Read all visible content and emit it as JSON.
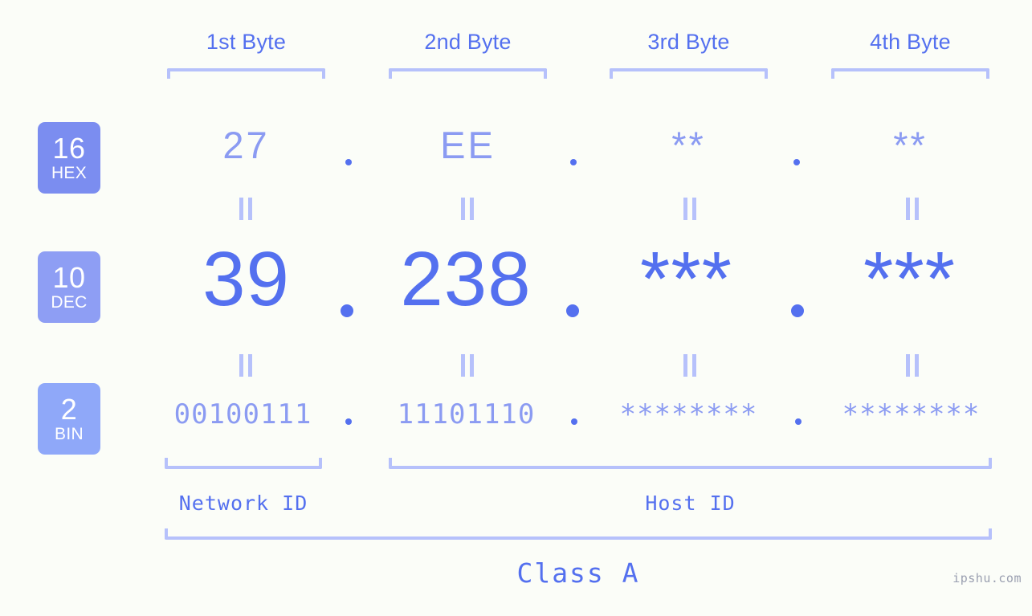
{
  "page": {
    "background_color": "#fbfdf8",
    "accent_color": "#5470ef",
    "muted_accent_color": "#8b9bf2",
    "bracket_color": "#b6c1fb",
    "watermark": "ipshu.com"
  },
  "columns": [
    {
      "label": "1st Byte"
    },
    {
      "label": "2nd Byte"
    },
    {
      "label": "3rd Byte"
    },
    {
      "label": "4th Byte"
    }
  ],
  "rows": [
    {
      "badge_number": "16",
      "badge_system": "HEX",
      "badge_color": "#7b8df0",
      "values": [
        "27",
        "EE",
        "**",
        "**"
      ],
      "separators": [
        ".",
        ".",
        "."
      ]
    },
    {
      "badge_number": "10",
      "badge_system": "DEC",
      "badge_color": "#8e9ef4",
      "values": [
        "39",
        "238",
        "***",
        "***"
      ],
      "separators": [
        ".",
        ".",
        "."
      ]
    },
    {
      "badge_number": "2",
      "badge_system": "BIN",
      "badge_color": "#8fa8f9",
      "values": [
        "00100111",
        "11101110",
        "********",
        "********"
      ],
      "separators": [
        ".",
        ".",
        "."
      ]
    }
  ],
  "equality_marks": {
    "symbol": "||",
    "count_per_gap": 4,
    "gaps": 2
  },
  "segments": {
    "network_id": "Network ID",
    "host_id": "Host ID"
  },
  "class": {
    "label": "Class A"
  }
}
